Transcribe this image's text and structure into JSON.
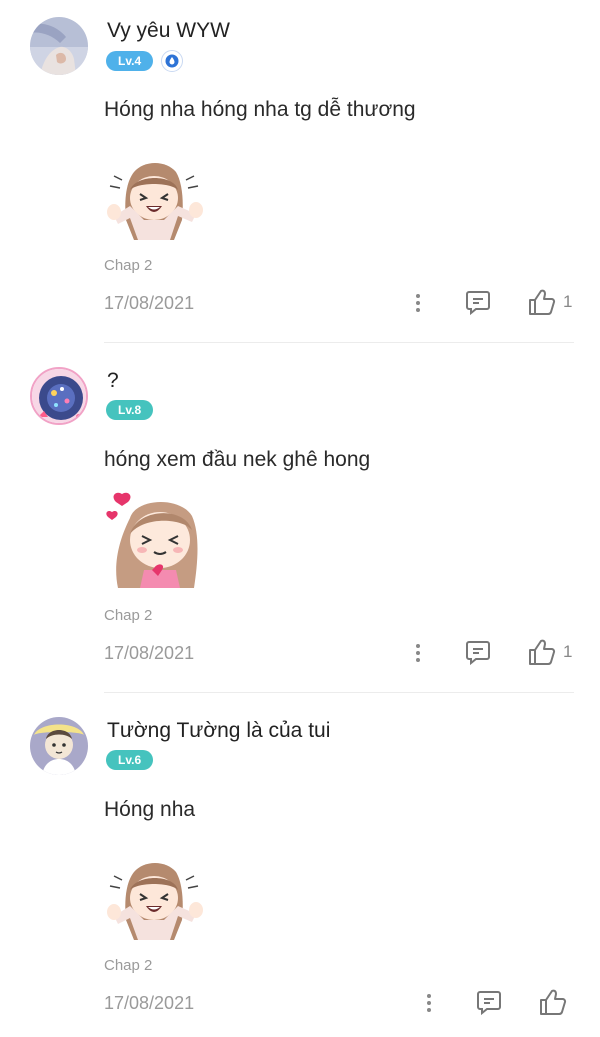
{
  "comments": [
    {
      "username": "Vy yêu WYW",
      "level": "Lv.4",
      "level_color": "#4fb1ea",
      "has_vip_badge": true,
      "text": "Hóng nha hóng nha tg dễ thương",
      "sticker": "girl-cheering-sticker",
      "chapter": "Chap 2",
      "date": "17/08/2021",
      "likes": "1"
    },
    {
      "username": "?",
      "level": "Lv.8",
      "level_color": "#45c3be",
      "has_vip_badge": false,
      "text": "hóng xem đầu nek ghê hong",
      "sticker": "girl-heart-sticker",
      "chapter": "Chap 2",
      "date": "17/08/2021",
      "likes": "1"
    },
    {
      "username": "Tường Tường là của tui",
      "level": "Lv.6",
      "level_color": "#45c3be",
      "has_vip_badge": false,
      "text": "Hóng nha",
      "sticker": "girl-cheering-sticker",
      "chapter": "Chap 2",
      "date": "17/08/2021",
      "likes": ""
    }
  ],
  "icons": {
    "more": "more-vertical-icon",
    "reply": "reply-comment-icon",
    "like": "thumbs-up-icon",
    "vip": "vip-drop-badge-icon"
  }
}
